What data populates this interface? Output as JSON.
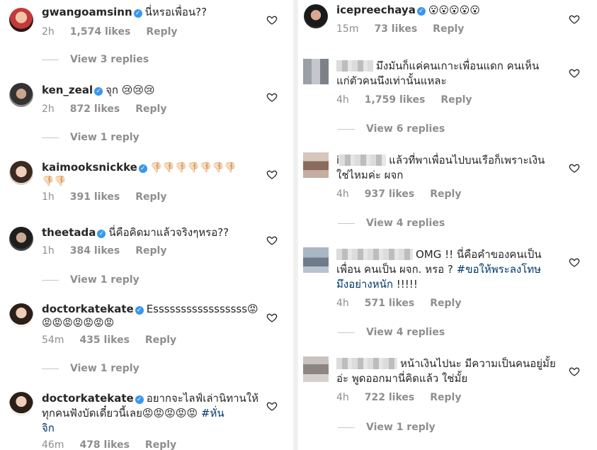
{
  "left": {
    "comments": [
      {
        "user": "gwangoamsinn",
        "verified": true,
        "text": "นี่หรอเพื่อน??",
        "time": "2h",
        "likes": "1,574 likes",
        "reply": "Reply",
        "view_replies": "View 3 replies"
      },
      {
        "user": "ken_zeal",
        "verified": true,
        "text": "จุก 😢😢😢",
        "time": "2h",
        "likes": "872 likes",
        "reply": "Reply",
        "view_replies": "View 1 reply"
      },
      {
        "user": "kaimooksnickke",
        "verified": true,
        "text_line1": "👎🏻👎🏻👎🏻👎🏻👎🏻👎🏻👎🏻",
        "text_line2": "👎🏻👎🏻",
        "time": "1h",
        "likes": "391 likes",
        "reply": "Reply"
      },
      {
        "user": "theetada",
        "verified": true,
        "text": "นี่คือคิดมาแล้วจริงๆหรอ??",
        "time": "1h",
        "likes": "384 likes",
        "reply": "Reply",
        "view_replies": "View 1 reply"
      },
      {
        "user": "doctorkatekate",
        "verified": true,
        "text_line1": "Esssssssssssssssss😡",
        "text_line2": "😡😡😡😡😡😡😡",
        "time": "54m",
        "likes": "435 likes",
        "reply": "Reply",
        "view_replies": "View 1 reply"
      },
      {
        "user": "doctorkatekate",
        "verified": true,
        "text_line1": "อยากจะไลฟ์เล่านิทานให้",
        "text_line2": "ทุกคนฟังบัดเดี๋ยวนี้เลย😡😡😡😡😡",
        "hashtag_a": "#หั่น",
        "hashtag_b": "จิก",
        "time": "46m",
        "likes": "478 likes",
        "reply": "Reply"
      }
    ]
  },
  "right": {
    "comments": [
      {
        "user": "icepreechaya",
        "verified": true,
        "text": "😮😮😮😮😮",
        "time": "15m",
        "likes": "73 likes",
        "reply": "Reply"
      },
      {
        "text_line1": "มึงมันก็แค่คนเกาะเพื่อนแดก คนเห็น",
        "text_line2": "แก่ตัวคนนึงเท่านั้นแหละ",
        "time": "4h",
        "likes": "1,759 likes",
        "reply": "Reply",
        "view_replies": "View 6 replies"
      },
      {
        "user_prefix": "i",
        "text_line1": "แล้วที่พาเพื่อนไปบนเรือก็เพราะเงิน",
        "text_line2": "ใช่ไหมค่ะ ผจก",
        "time": "4h",
        "likes": "937 likes",
        "reply": "Reply",
        "view_replies": "View 4 replies"
      },
      {
        "text_line1": "OMG !! นี่คือคำของคนเป็น",
        "text_line2": "เพื่อน คนเป็น ผจก. หรอ ?",
        "hashtag_a": "#ขอให้พระลงโทษ",
        "hashtag_b": "มึงอย่างหนัก",
        "text_tail": "!!!!!",
        "time": "4h",
        "likes": "571 likes",
        "reply": "Reply",
        "view_replies": "View 4 replies"
      },
      {
        "text_line1": "หน้าเงินไปนะ มีความเป็นคนอยู่มั้ย",
        "text_line2": "อ่ะ พูดออกมานี่คิดแล้ว ใช่มั้ย",
        "time": "4h",
        "likes": "722 likes",
        "reply": "Reply",
        "view_replies": "View 1 reply"
      }
    ]
  },
  "colors": {
    "verified": "#3897f0",
    "hashtag": "#00376b",
    "meta": "#8e8e8e",
    "text": "#262626"
  },
  "icons": {
    "heart": "heart-icon",
    "verified": "verified-badge-icon"
  }
}
